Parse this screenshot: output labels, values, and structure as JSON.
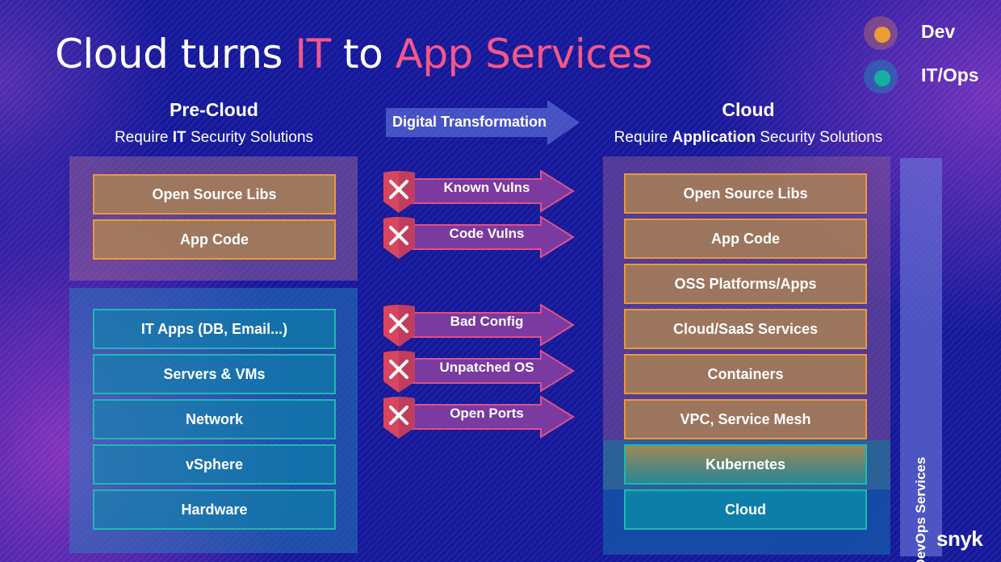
{
  "title": {
    "part1": "Cloud turns ",
    "accent1": "IT",
    "part2": " to ",
    "accent2": "App Services",
    "accent_color": "#f4578a"
  },
  "legend": [
    {
      "label": "Dev",
      "color": "#e8a030",
      "icon": "dev-dot-icon"
    },
    {
      "label": "IT/Ops",
      "color": "#14b0a0",
      "icon": "itops-dot-icon"
    }
  ],
  "pre_cloud": {
    "heading": "Pre-Cloud",
    "subtitle_pre": "Require ",
    "subtitle_bold": "IT",
    "subtitle_post": " Security Solutions",
    "dev_layers": [
      "Open Source Libs",
      "App Code"
    ],
    "ops_layers": [
      "IT Apps (DB, Email...)",
      "Servers & VMs",
      "Network",
      "vSphere",
      "Hardware"
    ]
  },
  "transition": {
    "label": "Digital Transformation",
    "icon": "right-arrow-icon"
  },
  "threats": [
    {
      "label": "Known Vulns",
      "icon": "shield-x-icon"
    },
    {
      "label": "Code Vulns",
      "icon": "shield-x-icon"
    },
    {
      "label": "Bad Config",
      "icon": "shield-x-icon"
    },
    {
      "label": "Unpatched OS",
      "icon": "shield-x-icon"
    },
    {
      "label": "Open Ports",
      "icon": "shield-x-icon"
    }
  ],
  "cloud": {
    "heading": "Cloud",
    "subtitle_pre": "Require ",
    "subtitle_bold": "Application",
    "subtitle_post": " Security Solutions",
    "dev_layers": [
      "Open Source Libs",
      "App Code",
      "OSS Platforms/Apps",
      "Cloud/SaaS Services",
      "Containers",
      "VPC, Service Mesh"
    ],
    "shared_layers": [
      "Kubernetes"
    ],
    "ops_layers": [
      "Cloud"
    ],
    "side_bar": "DevOps Services"
  },
  "brand": "snyk",
  "colors": {
    "dev": "#e89a3a",
    "ops": "#20b8b0",
    "threat_shield": "#d8455f",
    "threat_arrow": "#7a3aa0"
  }
}
